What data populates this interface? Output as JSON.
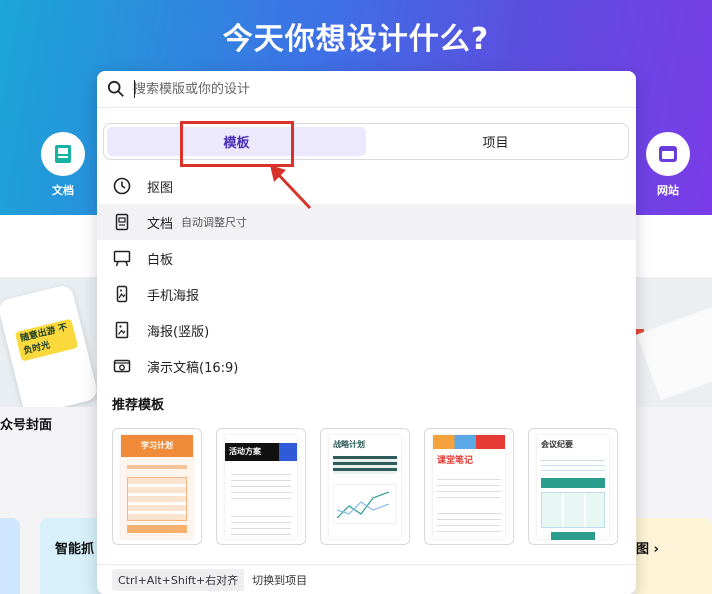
{
  "hero": {
    "title": "今天你想设计什么?"
  },
  "categories": {
    "doc": "文档",
    "web": "网站"
  },
  "search": {
    "placeholder": "搜索模版或你的设计"
  },
  "tabs": [
    {
      "label": "模板",
      "active": true
    },
    {
      "label": "项目",
      "active": false
    }
  ],
  "menu": [
    {
      "icon": "clock-icon",
      "label": "抠图"
    },
    {
      "icon": "document-icon",
      "label": "文档",
      "sub": "自动调整尺寸"
    },
    {
      "icon": "whiteboard-icon",
      "label": "白板"
    },
    {
      "icon": "phone-poster-icon",
      "label": "手机海报"
    },
    {
      "icon": "poster-icon",
      "label": "海报(竖版)"
    },
    {
      "icon": "presentation-icon",
      "label": "演示文稿(16:9)"
    }
  ],
  "recommended": {
    "title": "推荐模板",
    "templates": [
      {
        "name": "学习计划",
        "color": "#f08b3a"
      },
      {
        "name": "活动方案",
        "color": "#111111"
      },
      {
        "name": "战略计划",
        "color": "#2d5d5a"
      },
      {
        "name": "课堂笔记",
        "color": "#e53b34"
      },
      {
        "name": "会议纪要",
        "color": "#2a9d8f"
      }
    ]
  },
  "footer": {
    "shortcut": "Ctrl+Alt+Shift+右对齐",
    "switch": "切换到项目"
  },
  "background": {
    "left_card_label": "众号封面",
    "left_tile_label": "智能抓",
    "right_tile_label": "图 ›",
    "phone_sticker": "随意出游 不负时光"
  },
  "colors": {
    "accent": "#7a3ce8",
    "highlight": "#d8322b"
  }
}
